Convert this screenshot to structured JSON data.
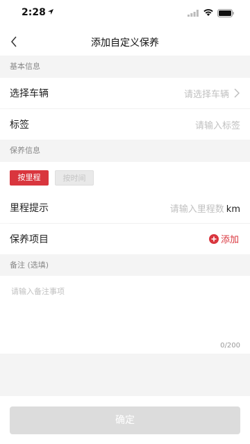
{
  "status_bar": {
    "time": "2:28"
  },
  "nav": {
    "title": "添加自定义保养"
  },
  "sections": {
    "basic": "基本信息",
    "maintenance": "保养信息",
    "notes": "备注 (选填)"
  },
  "basic_info": {
    "vehicle_label": "选择车辆",
    "vehicle_placeholder": "请选择车辆",
    "tag_label": "标签",
    "tag_placeholder": "请输入标签"
  },
  "maintenance_info": {
    "mode_mileage": "按里程",
    "mode_time": "按时间",
    "selected_mode": "按里程",
    "mileage_label": "里程提示",
    "mileage_placeholder": "请输入里程数",
    "mileage_unit": "km",
    "items_label": "保养项目",
    "add_label": "添加"
  },
  "notes": {
    "placeholder": "请输入备注事项",
    "counter": "0/200"
  },
  "footer": {
    "confirm_label": "确定"
  },
  "colors": {
    "accent": "#d9363e",
    "disabled_button": "#dcdcdc",
    "placeholder": "#c0c0c0",
    "background": "#f4f4f4"
  },
  "icons": {
    "back": "chevron-left-icon",
    "vehicle_chevron": "chevron-right-icon",
    "add": "plus-circle-icon"
  }
}
